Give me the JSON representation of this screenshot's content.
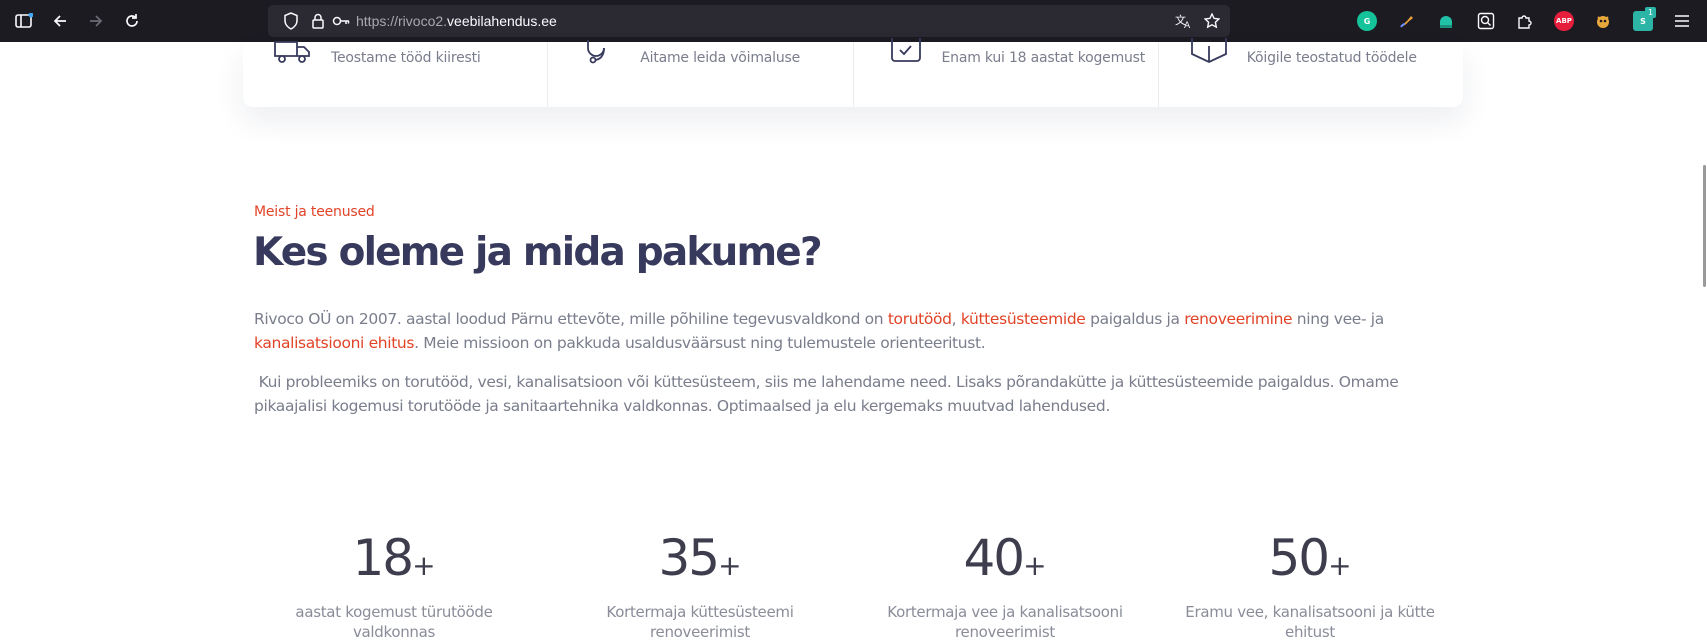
{
  "browser": {
    "url_prefix": "https://rivoco2.",
    "url_domain": "veebilahendus.ee",
    "extensions": [
      {
        "name": "grammarly-icon",
        "color": "#15c39a",
        "label": "G"
      },
      {
        "name": "brush-extension-icon",
        "color": "#e9a23b",
        "label": ""
      },
      {
        "name": "bubble-extension-icon",
        "color": "#21c2a8",
        "label": ""
      },
      {
        "name": "search-page-icon",
        "color": "#fbfbfe",
        "label": ""
      },
      {
        "name": "extensions-puzzle-icon",
        "color": "#fbfbfe",
        "label": ""
      },
      {
        "name": "adblock-plus-icon",
        "color": "#e51f3b",
        "label": "ABP"
      },
      {
        "name": "tampermonkey-icon",
        "color": "#e8a83c",
        "label": ""
      },
      {
        "name": "stylus-extension-icon",
        "color": "#2cb5a6",
        "label": "S",
        "badge": "1"
      }
    ]
  },
  "features": [
    {
      "text": "Teostame tööd kiiresti",
      "icon": "delivery-truck-icon"
    },
    {
      "text": "Aitame leida võimaluse",
      "icon": "headset-icon"
    },
    {
      "text": "Enam kui 18 aastat kogemust",
      "icon": "clipboard-check-icon"
    },
    {
      "text": "Kõigile teostatud töödele",
      "icon": "box-icon"
    }
  ],
  "about": {
    "eyebrow": "Meist ja teenused",
    "title": "Kes oleme ja mida pakume?",
    "p1": {
      "t1": "Rivoco OÜ on 2007. aastal loodud Pärnu ettevõte, mille põhiline tegevusvaldkond on ",
      "l1": "torutööd",
      "t2": ", ",
      "l2": "küttesüsteemide",
      "t3": " paigaldus ja ",
      "l3": "renoveerimine",
      "t4": " ning vee- ja ",
      "l4": "kanalisatsiooni ehitus",
      "t5": ". Meie missioon on pakkuda usaldusväärsust ning tulemustele orienteeritust."
    },
    "p2": " Kui probleemiks on torutööd, vesi, kanalisatsioon või küttesüsteem, siis me lahendame need. Lisaks põrandakütte ja küttesüsteemide paigaldus. Omame pikaajalisi kogemusi torutööde ja sanitaartehnika valdkonnas. Optimaalsed ja elu kergemaks muutvad lahendused."
  },
  "stats": [
    {
      "number": "18",
      "suffix": "+",
      "label": "aastat kogemust türutööde valdkonnas"
    },
    {
      "number": "35",
      "suffix": "+",
      "label": "Kortermaja küttesüsteemi renoveerimist"
    },
    {
      "number": "40",
      "suffix": "+",
      "label": "Kortermaja vee ja kanalisatsooni renoveerimist"
    },
    {
      "number": "50",
      "suffix": "+",
      "label": "Eramu vee, kanalisatsooni ja kütte ehitust"
    }
  ],
  "colors": {
    "accent": "#e14327",
    "heading": "#373a5c",
    "body_text": "#7a7d8c"
  }
}
